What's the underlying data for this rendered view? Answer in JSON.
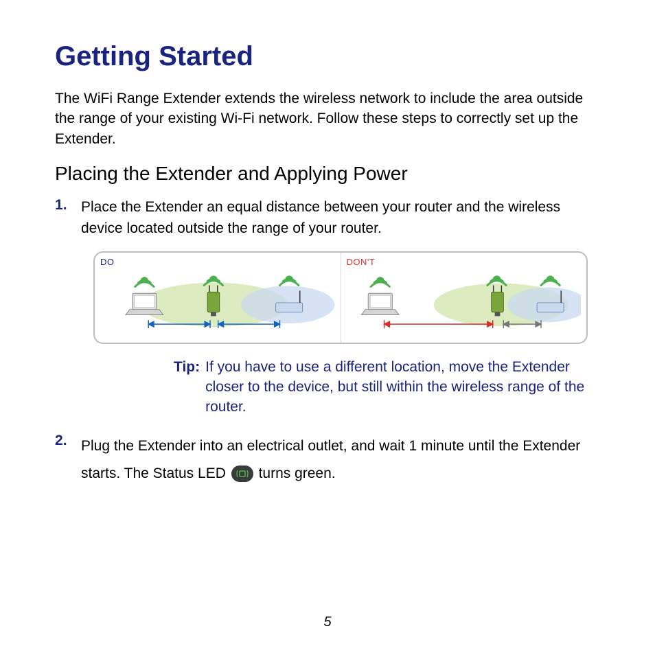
{
  "title": "Getting Started",
  "intro": "The WiFi Range Extender extends the wireless network to include the area outside the range of your existing Wi-Fi network. Follow these steps to correctly set up the Extender.",
  "subtitle": "Placing the Extender and Applying Power",
  "steps": {
    "one": "Place the Extender an equal distance between your router and the wireless device located outside the range of your router.",
    "two_a": "Plug the Extender into an electrical outlet, and wait 1 minute until the Extender starts. The Status LED ",
    "two_b": " turns green."
  },
  "diagram": {
    "do_label": "DO",
    "dont_label": "DON'T"
  },
  "tip": {
    "label": "Tip:",
    "text": "If you have to use a different location, move the Extender closer to the device, but still within the wireless range of the router."
  },
  "page_number": "5"
}
